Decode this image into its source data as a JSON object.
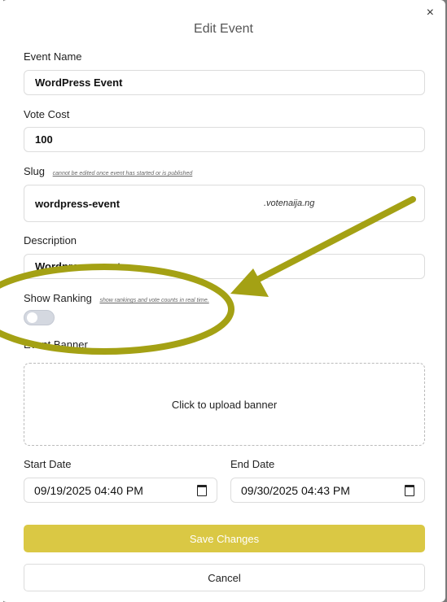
{
  "modal": {
    "title": "Edit Event",
    "close_icon": "×"
  },
  "fields": {
    "event_name": {
      "label": "Event Name",
      "value": "WordPress Event"
    },
    "vote_cost": {
      "label": "Vote Cost",
      "value": "100"
    },
    "slug": {
      "label": "Slug",
      "hint": "cannot be edited once event has started or is published",
      "value": "wordpress-event",
      "suffix": ".votenaija.ng"
    },
    "description": {
      "label": "Description",
      "value": "Wordpress event"
    },
    "show_ranking": {
      "label": "Show Ranking",
      "hint": "show rankings and vote counts in real time.",
      "enabled": false
    },
    "event_banner": {
      "label": "Event Banner",
      "upload_text": "Click to upload banner"
    },
    "start_date": {
      "label": "Start Date",
      "value": "09/19/2025 04:40 PM"
    },
    "end_date": {
      "label": "End Date",
      "value": "09/30/2025 04:43 PM"
    }
  },
  "buttons": {
    "save": "Save Changes",
    "cancel": "Cancel"
  },
  "colors": {
    "accent": "#dac844",
    "annotation": "#a4a114"
  }
}
